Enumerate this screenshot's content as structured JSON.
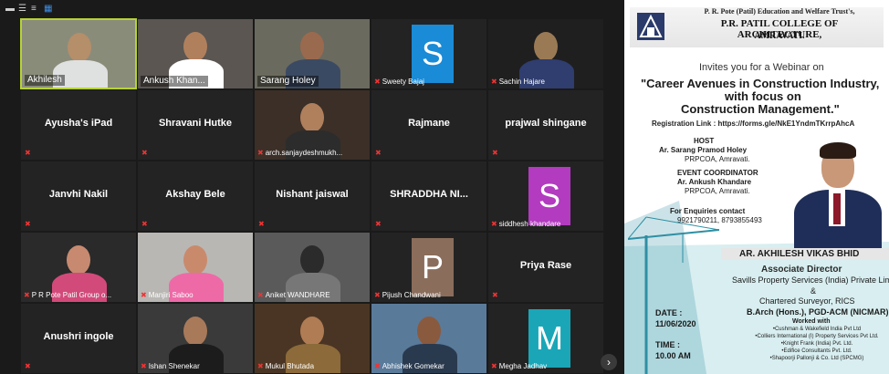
{
  "participants": [
    {
      "name": "Akhilesh",
      "kind": "video",
      "active": true
    },
    {
      "name": "Ankush Khan...",
      "kind": "video"
    },
    {
      "name": "Sarang Holey",
      "kind": "video"
    },
    {
      "name": "Sweety Bajaj",
      "kind": "avatar",
      "letter": "S",
      "color": "#1a8bd6"
    },
    {
      "name": "Sachin Hajare",
      "kind": "video"
    },
    {
      "name": "Ayusha's iPad",
      "kind": "name"
    },
    {
      "name": "Shravani Hutke",
      "kind": "name"
    },
    {
      "name": "arch.sanjaydeshmukh...",
      "kind": "video"
    },
    {
      "name": "Rajmane",
      "kind": "name"
    },
    {
      "name": "prajwal shingane",
      "kind": "name"
    },
    {
      "name": "Janvhi Nakil",
      "kind": "name"
    },
    {
      "name": "Akshay Bele",
      "kind": "name"
    },
    {
      "name": "Nishant jaiswal",
      "kind": "name"
    },
    {
      "name": "SHRADDHA NI...",
      "kind": "name"
    },
    {
      "name": "siddhesh khandare",
      "kind": "avatar",
      "letter": "S",
      "color": "#b23bbf"
    },
    {
      "name": "P R Pote Patil Group o...",
      "kind": "video"
    },
    {
      "name": "Manjiri Saboo",
      "kind": "video"
    },
    {
      "name": "Aniket WANDHARE",
      "kind": "video"
    },
    {
      "name": "Pijush Chandwani",
      "kind": "avatar",
      "letter": "P",
      "color": "#8a6d5b"
    },
    {
      "name": "Priya Rase",
      "kind": "name"
    },
    {
      "name": "Anushri ingole",
      "kind": "name"
    },
    {
      "name": "Ishan Shenekar",
      "kind": "video"
    },
    {
      "name": "Mukul Bhutada",
      "kind": "video"
    },
    {
      "name": "Abhishek Gomekar",
      "kind": "video"
    },
    {
      "name": "Megha Jadhav",
      "kind": "avatar",
      "letter": "M",
      "color": "#1aa6b7"
    }
  ],
  "nav": {
    "next_icon": "›"
  },
  "flyer": {
    "trust": "P. R. Pote (Patil) Education and Welfare Trust's,",
    "college": "P.R. PATIL COLLEGE OF ARCHITECTURE,",
    "city": "AMRAVATI.",
    "invites": "Invites you for a Webinar on",
    "title_1": "\"Career Avenues in Construction Industry,",
    "title_2": "with focus on",
    "title_3": "Construction Management.\"",
    "registration": "Registration Link : https://forms.gle/NkE1YndmTKrrpAhcA",
    "host_label": "HOST",
    "host_name": "Ar. Sarang Pramod Holey",
    "host_org": "PRPCOA, Amravati.",
    "coord_label": "EVENT COORDINATOR",
    "coord_name": "Ar. Ankush Khandare",
    "coord_org": "PRPCOA, Amravati.",
    "enquiry_label": "For Enquiries contact",
    "enquiry_phones": "9921790211, 8793855493",
    "speaker": "AR. AKHILESH VIKAS BHID",
    "speaker_role": "Associate Director",
    "speaker_company": "Savills Property Services (India) Private Limite",
    "amp": "&",
    "speaker_role2": "Chartered Surveyor, RICS",
    "qualification": "B.Arch (Hons.), PGD-ACM (NICMAR).",
    "worked_with": "Worked with",
    "companies": [
      "Cushman & Wakefield India Pvt Ltd",
      "Colliers International (I) Property Services Pvt Ltd.",
      "Knight Frank (India) Pvt. Ltd.",
      "Edifice Consultants Pvt. Ltd.",
      "Shapoorji Pallonji & Co. Ltd (SPCMG)"
    ],
    "date_label": "DATE :",
    "date": "11/06/2020",
    "time_label": "TIME :",
    "time": "10.00 AM"
  }
}
